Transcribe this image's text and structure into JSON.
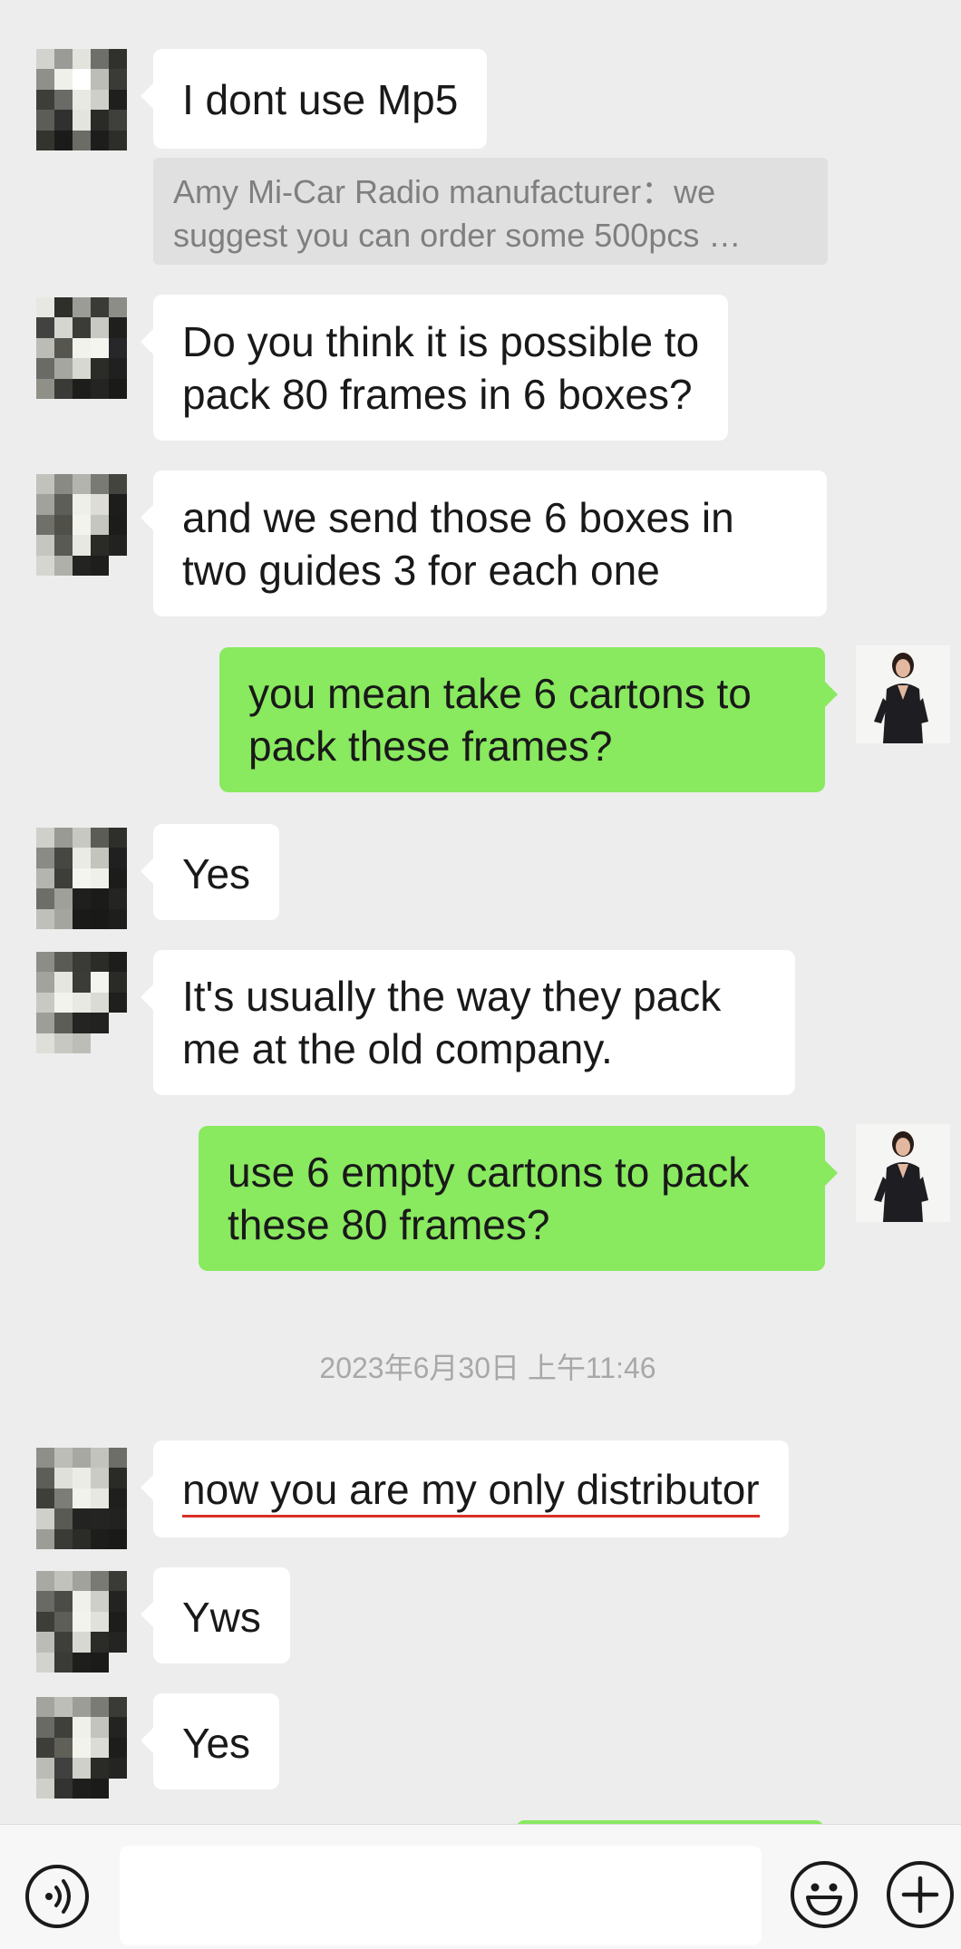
{
  "messages": [
    {
      "text": "I dont use Mp5"
    },
    {
      "quote": "Amy Mi-Car Radio manufacturer：we suggest you can order some 500pcs …"
    },
    {
      "line1": "Do you think it is possible to",
      "line2": "pack 80 frames in 6 boxes?"
    },
    {
      "line1": "and we send those 6 boxes in",
      "line2": "two guides 3 for each one"
    },
    {
      "line1": "you mean take 6 cartons to",
      "line2": "pack these frames?"
    },
    {
      "text": "Yes"
    },
    {
      "line1": "It's usually the way they pack",
      "line2": "me at the old company."
    },
    {
      "line1": "use 6 empty cartons to pack",
      "line2": "these 80 frames?"
    },
    {
      "text": "now you are my only distributor"
    },
    {
      "text": "Yws"
    },
    {
      "text": "Yes"
    }
  ],
  "timestamp": "2023年6月30日 上午11:46",
  "input": {
    "value": "",
    "placeholder": ""
  },
  "colors": {
    "incoming": "#ffffff",
    "outgoing": "#89e95f",
    "background": "#ededed",
    "underline": "#d93025"
  },
  "icons": {
    "voice": "voice-icon",
    "emoji": "emoji-icon",
    "plus": "plus-icon"
  }
}
